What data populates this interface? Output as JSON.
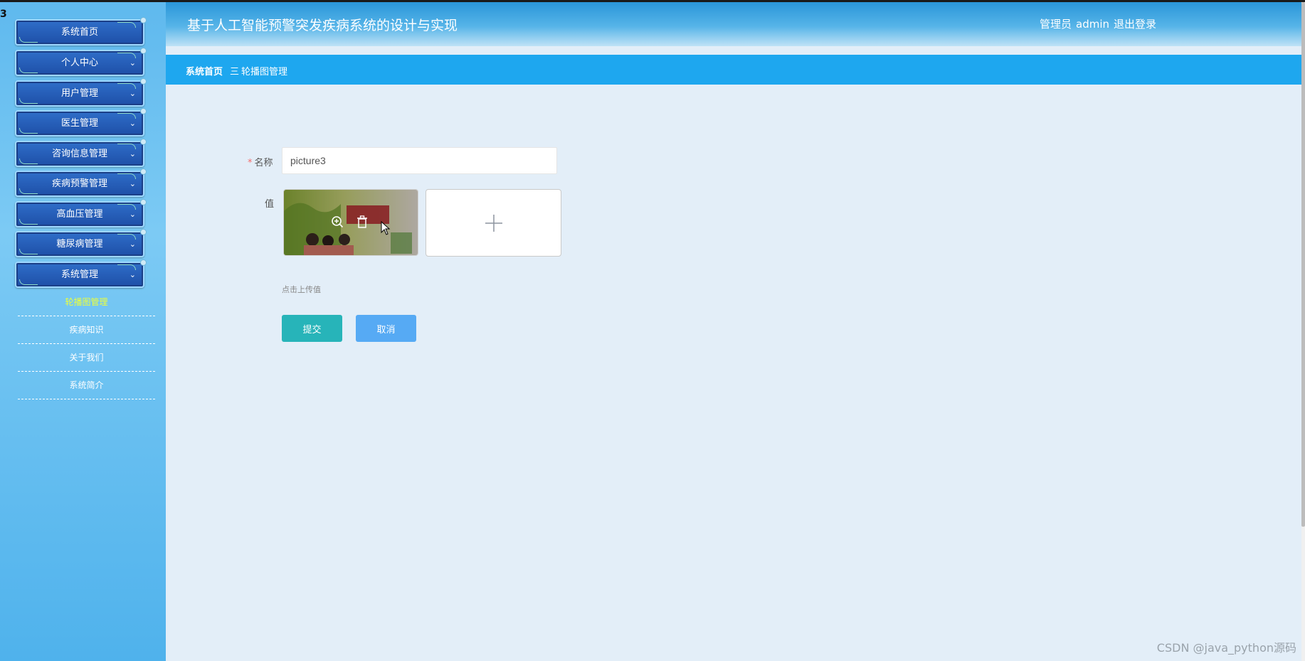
{
  "corner_glyph": "3",
  "sidebar": {
    "menu": [
      {
        "label": "系统首页"
      },
      {
        "label": "个人中心"
      },
      {
        "label": "用户管理"
      },
      {
        "label": "医生管理"
      },
      {
        "label": "咨询信息管理"
      },
      {
        "label": "疾病预警管理"
      },
      {
        "label": "高血压管理"
      },
      {
        "label": "糖尿病管理"
      },
      {
        "label": "系统管理"
      }
    ],
    "submenu": [
      {
        "label": "轮播图管理",
        "active": true
      },
      {
        "label": "疾病知识"
      },
      {
        "label": "关于我们"
      },
      {
        "label": "系统简介"
      }
    ]
  },
  "header": {
    "title": "基于人工智能预警突发疾病系统的设计与实现",
    "user_role": "管理员",
    "username": "admin",
    "logout": "退出登录"
  },
  "breadcrumb": {
    "home": "系统首页",
    "separator": "三",
    "current": "轮播图管理"
  },
  "form": {
    "name_label": "名称",
    "name_value": "picture3",
    "value_label": "值",
    "upload_hint": "点击上传值",
    "submit": "提交",
    "cancel": "取消"
  },
  "watermark": "CSDN @java_python源码",
  "colors": {
    "sidebar": "#5fb9ee",
    "header": "#2a96d9",
    "breadcrumb_bar": "#1ea7ef",
    "submit": "#27b4b9",
    "cancel": "#56aaf4",
    "active_submenu": "#ecff3a"
  }
}
